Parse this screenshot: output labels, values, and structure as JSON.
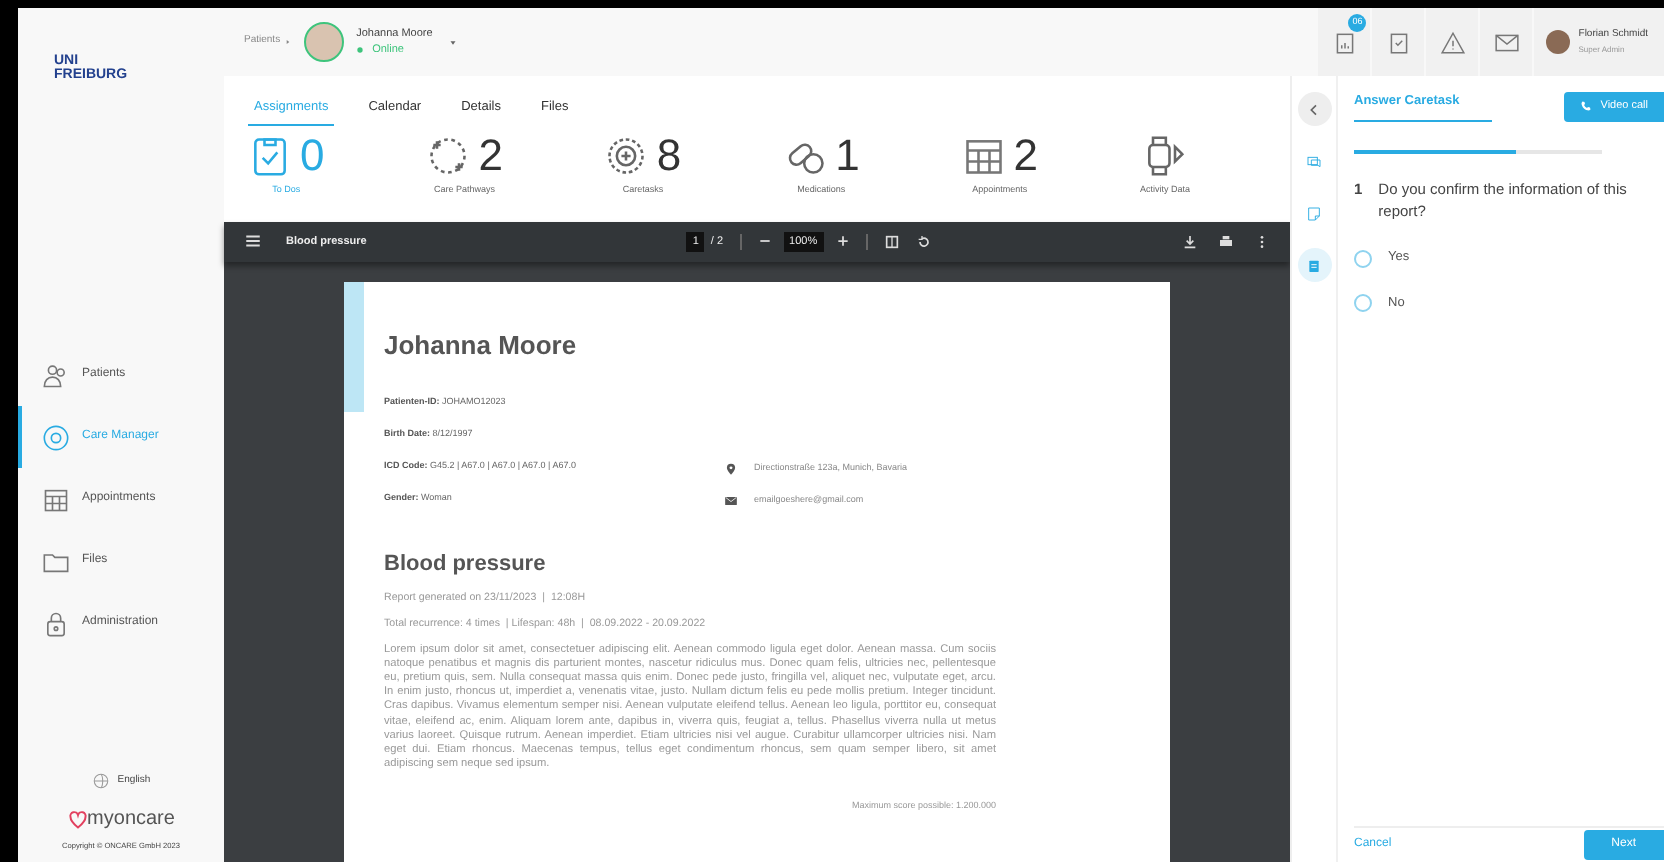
{
  "sidebar": {
    "logo_top": "UNI",
    "logo_bottom": "FREIBURG",
    "items": [
      {
        "label": "Patients",
        "selected": false,
        "kind": "patients"
      },
      {
        "label": "Care Manager",
        "selected": true,
        "kind": "care"
      },
      {
        "label": "Appointments",
        "selected": false,
        "kind": "calendar"
      },
      {
        "label": "Files",
        "selected": false,
        "kind": "folder"
      },
      {
        "label": "Administration",
        "selected": false,
        "kind": "lock"
      }
    ],
    "language": "English",
    "brand": "myoncare",
    "copyright": "Copyright © ONCARE GmbH 2023"
  },
  "header": {
    "breadcrumb": "Patients",
    "patient_name": "Johanna Moore",
    "patient_status": "Online",
    "notification_count": "06",
    "user_name": "Florian Schmidt",
    "user_role": "Super Admin"
  },
  "tabs": [
    {
      "label": "Assignments",
      "selected": true
    },
    {
      "label": "Calendar",
      "selected": false
    },
    {
      "label": "Details",
      "selected": false
    },
    {
      "label": "Files",
      "selected": false
    }
  ],
  "stats": [
    {
      "kind": "todo",
      "value": "0",
      "label": "To Dos"
    },
    {
      "kind": "pathway",
      "value": "2",
      "label": "Care Pathways"
    },
    {
      "kind": "caretask",
      "value": "8",
      "label": "Caretasks"
    },
    {
      "kind": "pills",
      "value": "1",
      "label": "Medications"
    },
    {
      "kind": "calendar",
      "value": "2",
      "label": "Appointments"
    },
    {
      "kind": "watch",
      "label": "Activity Data"
    }
  ],
  "viewer": {
    "title": "Blood pressure",
    "page": "1",
    "page_total": "/ 2",
    "zoom": "100%"
  },
  "document": {
    "name": "Johanna Moore",
    "fields": [
      {
        "label": "Patienten-ID:",
        "value": "JOHAMO12023"
      },
      {
        "label": "Birth Date:",
        "value": "8/12/1997"
      },
      {
        "label": "ICD Code:",
        "value": "G45.2  |  A67.0  |  A67.0  |  A67.0  |  A67.0"
      },
      {
        "label": "Gender:",
        "value": "Woman"
      }
    ],
    "contacts": [
      {
        "kind": "address",
        "text": "Directionstraße 123a, Munich, Bavaria"
      },
      {
        "kind": "email",
        "text": "emailgoeshere@gmail.com"
      }
    ],
    "report_title": "Blood pressure",
    "report_lines": [
      "Report generated on 23/11/2023  |  12:08H",
      "Total recurrence: 4 times  | Lifespan: 48h  |  08.09.2022 - 20.09.2022"
    ],
    "body": "Lorem ipsum dolor sit amet, consectetuer adipiscing elit. Aenean commodo ligula eget dolor. Aenean massa. Cum sociis natoque penatibus et magnis dis parturient montes, nascetur ridiculus mus. Donec quam felis, ultricies nec, pellentesque eu, pretium quis, sem. Nulla consequat massa quis enim. Donec pede justo, fringilla vel, aliquet nec, vulputate eget, arcu. In enim justo, rhoncus ut, imperdiet a, venenatis vitae, justo. Nullam dictum felis eu pede mollis pretium. Integer tincidunt. Cras dapibus. Vivamus elementum semper nisi. Aenean vulputate eleifend tellus. Aenean leo ligula, porttitor eu, consequat vitae, eleifend ac, enim. Aliquam lorem ante, dapibus in, viverra quis, feugiat a, tellus. Phasellus viverra nulla ut metus varius laoreet. Quisque rutrum. Aenean imperdiet. Etiam ultricies nisi vel augue. Curabitur ullamcorper ultricies nisi. Nam eget dui. Etiam rhoncus. Maecenas tempus, tellus eget condimentum rhoncus, sem quam semper libero, sit amet adipiscing sem neque sed ipsum.",
    "max_score": "Maximum score possible: 1.200.000"
  },
  "side_tools": [
    {
      "kind": "chat",
      "selected": false
    },
    {
      "kind": "note",
      "selected": false
    },
    {
      "kind": "clipboard",
      "selected": true
    }
  ],
  "caretask": {
    "tab": "Answer Caretask",
    "video_button": "Video call",
    "progress": {
      "level": 0.65
    },
    "question_number": "1",
    "question": "Do you confirm the information of this report?",
    "options": [
      {
        "label": "Yes",
        "selected": false
      },
      {
        "label": "No",
        "selected": false
      }
    ],
    "cancel": "Cancel",
    "next": "Next"
  }
}
